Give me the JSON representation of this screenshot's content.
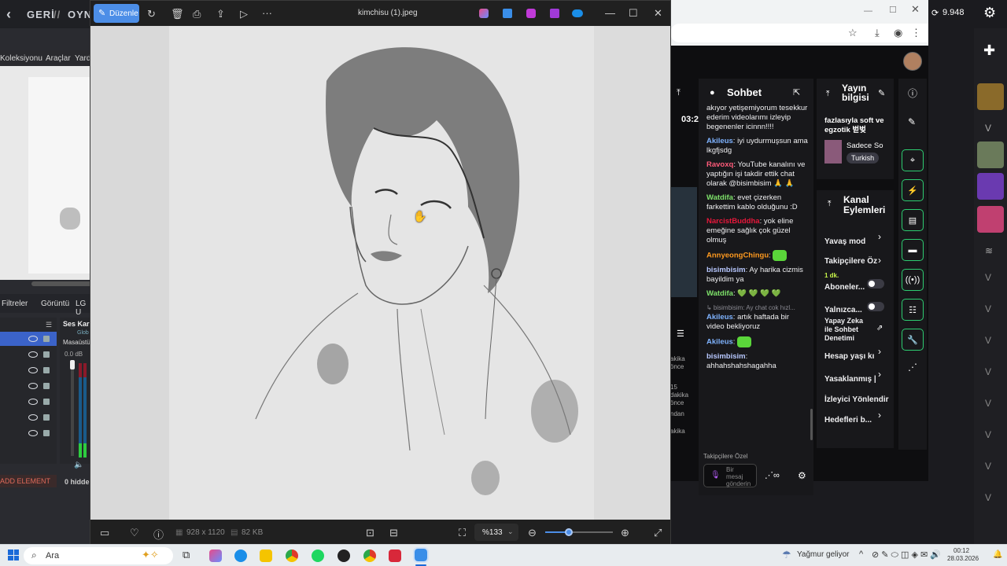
{
  "left_app": {
    "back_label": "GERİ",
    "separator": "//",
    "title_partial": "OYNA",
    "menu": [
      "Koleksiyonu",
      "Araçlar",
      "Yardı"
    ],
    "tabs": [
      "Filtreler",
      "Görüntü",
      "LG U"
    ],
    "audio_header": "Ses Karı",
    "audio_sub": "Glob",
    "audio_source": "Masaüstü",
    "audio_db": "0.0 dB",
    "add_element": "ADD ELEMENT",
    "hidden_count": "0 hidde"
  },
  "viewer": {
    "edit_button": "Düzenle",
    "filename": "kimchisu (1).jpeg",
    "dimensions": "928 x 1120",
    "file_size": "82 KB",
    "zoom": "%133",
    "zoom_fraction": 0.35
  },
  "browser": {
    "counter": "9.948"
  },
  "dash_partial": {
    "time": "03:2",
    "ago": [
      "akika",
      "önce",
      "15",
      "dakika",
      "önce",
      "ndan",
      "akika"
    ]
  },
  "chat": {
    "title": "Sohbet",
    "messages": [
      {
        "user": "",
        "text": "akıyor yetişemiyorum tesekkur ederim videolarımı izleyip begenenler icinnn!!!!",
        "color": "#efeff1"
      },
      {
        "user": "Akileus",
        "text": "iyi uydurmuşsun ama lkgfjsdg",
        "color": "#7fb3ff"
      },
      {
        "user": "Ravoxq",
        "text": "YouTube kanalını ve yaptığın işi takdir ettik chat olarak @bisimbisim 🙏 🙏",
        "color": "#ff5b7a"
      },
      {
        "user": "Watdifa",
        "text": "evet çizerken farkettim kablo olduğunu :D",
        "color": "#7ee26a"
      },
      {
        "user": "NarcistBuddha",
        "text": "yok eline emeğine sağlık çok güzel olmuş",
        "color": "#e8173b"
      },
      {
        "user": "AnnyeongChingu",
        "text": "",
        "color": "#ff9a1f"
      },
      {
        "user": "bisimbisim",
        "text": "Ay harika cizmis bayildim ya",
        "color": "#b8c8ff"
      },
      {
        "user": "Watdifa",
        "text": "💚 💚 💚 💚",
        "color": "#7ee26a"
      },
      {
        "user": "",
        "text": "↳ bisimbisim: Ay chat cok hızl...",
        "color": "#8a8a92"
      },
      {
        "user": "Akileus",
        "text": "artık haftada bir video bekliyoruz",
        "color": "#7fb3ff"
      },
      {
        "user": "Akileus",
        "text": "",
        "color": "#7fb3ff"
      },
      {
        "user": "bisimbisim",
        "text": "ahhahshahshagahha",
        "color": "#b8c8ff"
      }
    ],
    "followers_only": "Takipçilere Özel",
    "input_placeholder": "Bir mesaj gönderin"
  },
  "stream_info": {
    "title": "Yayın bilgisi",
    "stream_title": "fazlasıyla soft ve egzotik 벋벚",
    "category": "Sadece So",
    "tag": "Turkish"
  },
  "channel_actions": {
    "title": "Kanal Eylemleri",
    "items": [
      {
        "label": "Yavaş mod",
        "sub": ""
      },
      {
        "label": "Takipçilere Öz",
        "sub": "1 dk."
      },
      {
        "label": "Aboneler...",
        "sub": ""
      },
      {
        "label": "Yalnızca...",
        "sub": ""
      },
      {
        "label": "Yapay Zeka ile Sohbet Denetimi",
        "sub": ""
      },
      {
        "label": "Hesap yaşı kı",
        "sub": ""
      },
      {
        "label": "Yasaklanmış |",
        "sub": ""
      },
      {
        "label": "İzleyici Yönlendir",
        "sub": ""
      },
      {
        "label": "Hedefleri b...",
        "sub": ""
      }
    ]
  },
  "taskbar": {
    "search": "Ara",
    "weather": "Yağmur geliyor",
    "time": "00:12",
    "date": "28.03.2026"
  },
  "colors": {
    "accent_blue": "#4c8ee7",
    "twitch_green": "#2ecc71",
    "dash_bg": "#0e0e10"
  }
}
